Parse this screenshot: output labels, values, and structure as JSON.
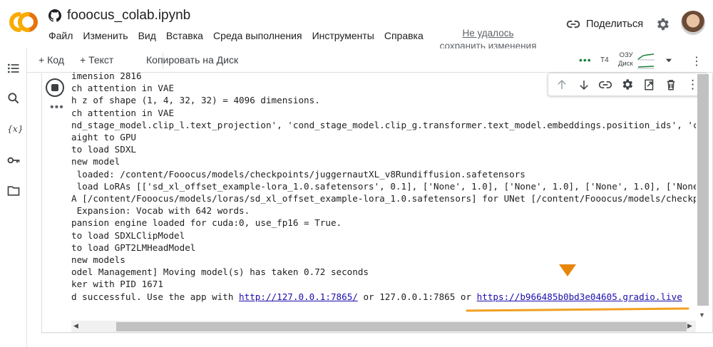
{
  "header": {
    "title": "fooocus_colab.ipynb",
    "menu": [
      "Файл",
      "Изменить",
      "Вид",
      "Вставка",
      "Среда выполнения",
      "Инструменты",
      "Справка"
    ],
    "save_status_line1": "Не удалось",
    "save_status_line2": "сохранить изменения",
    "share_label": "Поделиться"
  },
  "toolbar": {
    "add_code": "+ Код",
    "add_text": "+ Текст",
    "copy_drive": "Копировать на Диск",
    "gpu": "T4",
    "ram_label": "ОЗУ",
    "disk_label": "Диск"
  },
  "output_lines": [
    "imension 2816",
    "ch attention in VAE",
    "h z of shape (1, 4, 32, 32) = 4096 dimensions.",
    "ch attention in VAE",
    "nd_stage_model.clip_l.text_projection', 'cond_stage_model.clip_g.transformer.text_model.embeddings.position_ids', 'c",
    "aight to GPU",
    "to load SDXL",
    "new model",
    " loaded: /content/Fooocus/models/checkpoints/juggernautXL_v8Rundiffusion.safetensors",
    " load LoRAs [['sd_xl_offset_example-lora_1.0.safetensors', 0.1], ['None', 1.0], ['None', 1.0], ['None', 1.0], ['None",
    "A [/content/Fooocus/models/loras/sd_xl_offset_example-lora_1.0.safetensors] for UNet [/content/Fooocus/models/checkp",
    " Expansion: Vocab with 642 words.",
    "pansion engine loaded for cuda:0, use_fp16 = True.",
    "to load SDXLClipModel",
    "to load GPT2LMHeadModel",
    "new models",
    "odel Management] Moving model(s) has taken 0.72 seconds",
    "ker with PID 1671"
  ],
  "last_line": {
    "prefix": "d successful. Use the app with ",
    "local_link": "http://127.0.0.1:7865/",
    "middle": " or 127.0.0.1:7865 or ",
    "public_link": "https://b966485b0bd3e04605.gradio.live"
  },
  "colors": {
    "logo_orange": "#F9AB00",
    "logo_dark_orange": "#E8710A",
    "running_green": "#188038",
    "link_blue": "#1a0dab",
    "annotation_orange": "#F0A020"
  }
}
